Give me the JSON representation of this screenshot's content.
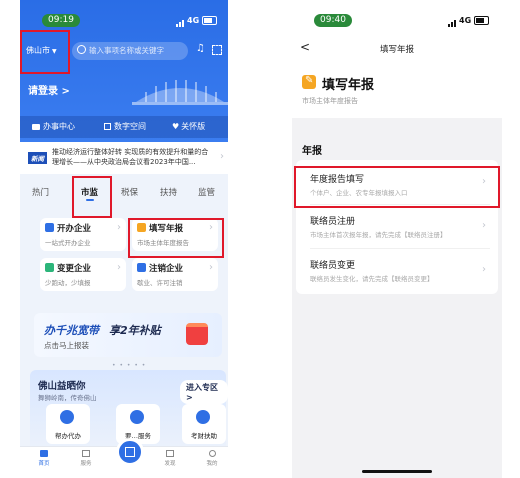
{
  "left": {
    "status": {
      "time": "09:19",
      "network": "4G"
    },
    "header": {
      "city": "佛山市",
      "search_placeholder": "输入事项名称或关键字",
      "login": "请登录 >"
    },
    "quick": [
      "办事中心",
      "数字空间",
      "关怀版"
    ],
    "news": {
      "tag": "新闻",
      "text": "推动经济运行整体好转 实现质的有效提升和量的合理增长——从中央政治局会议看2023年中国..."
    },
    "tabs": [
      "热门",
      "市监",
      "税保",
      "扶持",
      "监管"
    ],
    "services": [
      {
        "title": "开办企业",
        "sub": "一站式开办企业"
      },
      {
        "title": "填写年报",
        "sub": "市场主体年度报告"
      },
      {
        "title": "变更企业",
        "sub": "少跑动，少填报"
      },
      {
        "title": "注销企业",
        "sub": "歇业、许可注销"
      }
    ],
    "banner": {
      "title_a": "办千兆宽带",
      "title_b": "享2年补贴",
      "sub": "点击马上报装"
    },
    "section": {
      "title": "佛山益晒你",
      "sub": "舞狮岭南，传奇佛山",
      "enter": "进入专区 >"
    },
    "section_items": [
      "帮办代办",
      "要…服务",
      "考财扶助"
    ],
    "nav": [
      "首页",
      "服务",
      "",
      "发现",
      "我的"
    ]
  },
  "right": {
    "status": {
      "time": "09:40",
      "network": "4G"
    },
    "topbar": {
      "back": "<",
      "title": "填写年报"
    },
    "hero": {
      "title": "填写年报",
      "sub": "市场主体年度报告"
    },
    "section_title": "年报",
    "items": [
      {
        "title": "年度报告填写",
        "sub": "个体户、企业、农专年报填报入口"
      },
      {
        "title": "联络员注册",
        "sub": "市场主体首次报年报，请先完成【联络员注册】"
      },
      {
        "title": "联络员变更",
        "sub": "联络员发生变化，请先完成【联络员变更】"
      }
    ]
  },
  "colors": {
    "brand": "#2f6fe4",
    "highlight": "#e0182a",
    "orange": "#f5a623",
    "green": "#2cb57a"
  }
}
